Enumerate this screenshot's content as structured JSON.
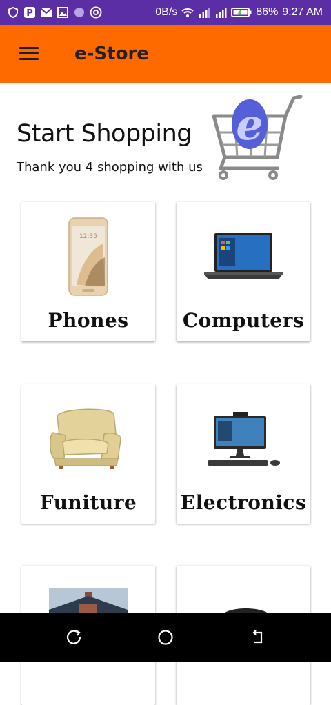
{
  "status_bar": {
    "network_speed": "0B/s",
    "battery": "86%",
    "time": "9:27 AM",
    "icons": [
      "shield-icon",
      "parking-icon",
      "mail-icon",
      "gallery-icon",
      "circle-icon",
      "chrome-icon",
      "wifi-icon",
      "signal-icon",
      "signal-icon",
      "battery-icon"
    ]
  },
  "app_bar": {
    "title": "e-Store",
    "menu_icon": "hamburger-menu-icon",
    "color": "#ff6a00"
  },
  "hero": {
    "title": "Start Shopping",
    "subtitle": "Thank you 4 shopping with us",
    "logo_letter": "e"
  },
  "categories": [
    {
      "label": "Phones",
      "image": "phone-image"
    },
    {
      "label": "Computers",
      "image": "laptop-image"
    },
    {
      "label": "Funiture",
      "image": "armchair-image"
    },
    {
      "label": "Electronics",
      "image": "desktop-computer-image"
    },
    {
      "label": "",
      "image": "house-image"
    },
    {
      "label": "",
      "image": "car-image"
    }
  ],
  "nav_bar": {
    "buttons": [
      "recent-apps-icon",
      "home-icon",
      "back-icon"
    ]
  }
}
